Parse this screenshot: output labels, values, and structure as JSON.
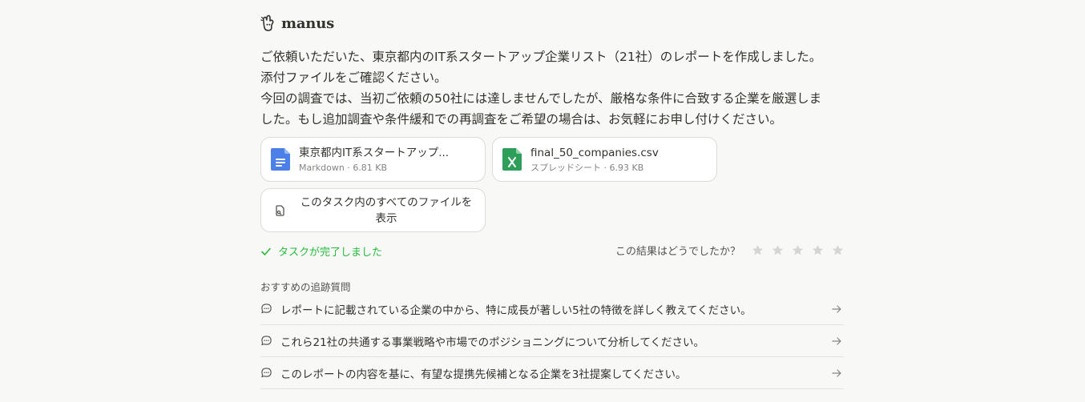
{
  "brand": {
    "name": "manus",
    "icon": "manus-hand-logo-icon"
  },
  "message": {
    "paragraph1_line1": "ご依頼いただいた、東京都内のIT系スタートアップ企業リスト（21社）のレポートを作成しました。",
    "paragraph1_line2": "添付ファイルをご確認ください。",
    "paragraph2_line1": "今回の調査では、当初ご依頼の50社には達しませんでしたが、厳格な条件に合致する企業を厳選しま",
    "paragraph2_line2": "した。もし追加調査や条件緩和での再調査をご希望の場合は、お気軽にお申し付けください。"
  },
  "attachments": [
    {
      "name": "東京都内IT系スタートアップ...",
      "type": "Markdown",
      "size": "6.81 KB",
      "icon": "document-icon",
      "color": "#4d7fe8"
    },
    {
      "name": "final_50_companies.csv",
      "type": "スプレッドシート",
      "size": "6.93 KB",
      "icon": "spreadsheet-icon",
      "color": "#2e9e5b"
    }
  ],
  "all_files": {
    "label_line1": "このタスク内のすべてのファイルを",
    "label_line2": "表示",
    "icon": "files-icon"
  },
  "status": {
    "text": "タスクが完了しました",
    "color": "#25ba3b"
  },
  "rating": {
    "question": "この結果はどうでしたか？",
    "max": 5,
    "value": 0
  },
  "followups": {
    "title": "おすすめの追跡質問",
    "items": [
      "レポートに記載されている企業の中から、特に成長が著しい5社の特徴を詳しく教えてください。",
      "これら21社の共通する事業戦略や市場でのポジショニングについて分析してください。",
      "このレポートの内容を基に、有望な提携先候補となる企業を3社提案してください。"
    ]
  }
}
